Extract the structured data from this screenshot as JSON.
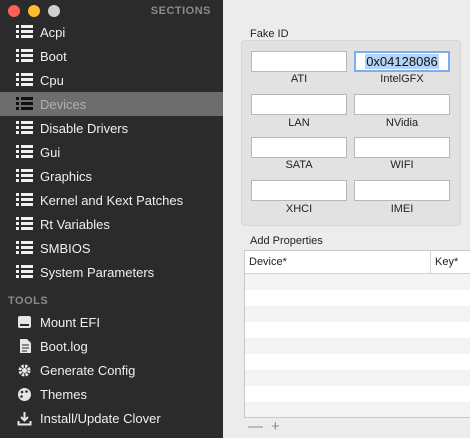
{
  "sidebar": {
    "sections_header": "SECTIONS",
    "tools_header": "TOOLS",
    "window_buttons": [
      "#ff5f57",
      "#febc2e",
      "#d0d0d0"
    ],
    "items": [
      {
        "label": "Acpi",
        "icon": "list-icon",
        "selected": false
      },
      {
        "label": "Boot",
        "icon": "list-icon",
        "selected": false
      },
      {
        "label": "Cpu",
        "icon": "list-icon",
        "selected": false
      },
      {
        "label": "Devices",
        "icon": "list-icon",
        "selected": true
      },
      {
        "label": "Disable Drivers",
        "icon": "list-icon",
        "selected": false
      },
      {
        "label": "Gui",
        "icon": "list-icon",
        "selected": false
      },
      {
        "label": "Graphics",
        "icon": "list-icon",
        "selected": false
      },
      {
        "label": "Kernel and Kext Patches",
        "icon": "list-icon",
        "selected": false
      },
      {
        "label": "Rt Variables",
        "icon": "list-icon",
        "selected": false
      },
      {
        "label": "SMBIOS",
        "icon": "list-icon",
        "selected": false
      },
      {
        "label": "System Parameters",
        "icon": "list-icon",
        "selected": false
      }
    ],
    "tools": [
      {
        "label": "Mount EFI",
        "icon": "drive-icon"
      },
      {
        "label": "Boot.log",
        "icon": "document-icon"
      },
      {
        "label": "Generate Config",
        "icon": "gear-icon"
      },
      {
        "label": "Themes",
        "icon": "palette-icon"
      },
      {
        "label": "Install/Update Clover",
        "icon": "download-icon"
      }
    ]
  },
  "fake_id": {
    "title": "Fake ID",
    "fields": {
      "ati": {
        "label": "ATI",
        "value": ""
      },
      "intelgfx": {
        "label": "IntelGFX",
        "value": "0x04128086"
      },
      "lan": {
        "label": "LAN",
        "value": ""
      },
      "nvidia": {
        "label": "NVidia",
        "value": ""
      },
      "sata": {
        "label": "SATA",
        "value": ""
      },
      "wifi": {
        "label": "WIFI",
        "value": ""
      },
      "xhci": {
        "label": "XHCI",
        "value": ""
      },
      "imei": {
        "label": "IMEI",
        "value": ""
      }
    }
  },
  "add_properties": {
    "title": "Add Properties",
    "columns": [
      "Device*",
      "Key*"
    ],
    "add_label": "+",
    "remove_label": "—"
  }
}
